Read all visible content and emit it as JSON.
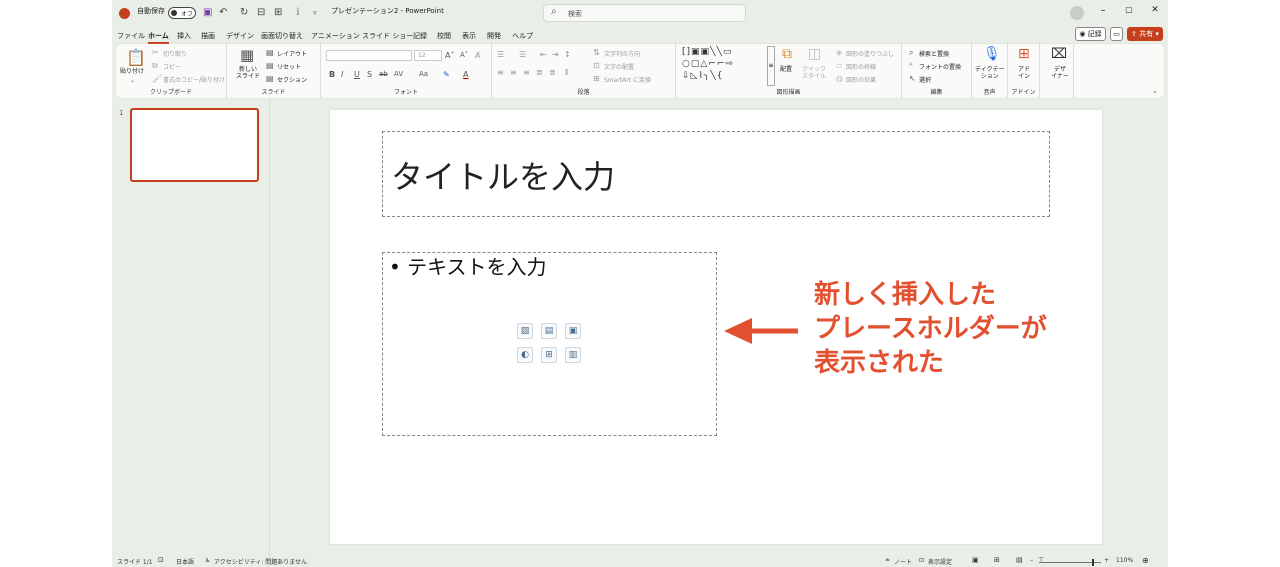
{
  "titlebar": {
    "autosave_label": "自動保存",
    "autosave_state": "オフ",
    "doc_title": "プレゼンテーション2 - PowerPoint",
    "search_placeholder": "検索",
    "win_min": "–",
    "win_max": "▢",
    "win_close": "✕"
  },
  "tabs": [
    "ファイル",
    "ホーム",
    "挿入",
    "描画",
    "デザイン",
    "画面切り替え",
    "アニメーション",
    "スライド ショー",
    "記録",
    "校閲",
    "表示",
    "開発",
    "ヘルプ"
  ],
  "active_tab": "ホーム",
  "top_right": {
    "record": "記録",
    "share": "共有"
  },
  "ribbon": {
    "clipboard": {
      "paste": "貼り付け",
      "cut": "切り取り",
      "copy": "コピー",
      "format_painter": "書式のコピー/貼り付け",
      "group": "クリップボード"
    },
    "slides": {
      "new_slide": "新しい\nスライド",
      "layout": "レイアウト",
      "reset": "リセット",
      "section": "セクション",
      "group": "スライド"
    },
    "font": {
      "size": "12",
      "group": "フォント",
      "styles": [
        "B",
        "I",
        "U",
        "S",
        "ab",
        "AV",
        "Aa",
        "A"
      ]
    },
    "paragraph": {
      "text_direction": "文字列の方向",
      "align_text": "文字の配置",
      "smartart": "SmartArt に変換",
      "group": "段落"
    },
    "drawing": {
      "arrange": "配置",
      "quick_styles": "クイック\nスタイル",
      "shape_fill": "図形の塗りつぶし",
      "shape_outline": "図形の枠線",
      "shape_effects": "図形の効果",
      "group": "図形描画"
    },
    "editing": {
      "find_replace": "検索と置換",
      "replace_font": "フォントの置換",
      "select": "選択",
      "group": "編集"
    },
    "voice": {
      "dictate": "ディクテー\nション",
      "group": "音声"
    },
    "addins": {
      "label": "アド\nイン",
      "group": "アドイン"
    },
    "designer": {
      "label": "デザ\nイナー"
    }
  },
  "thumbnail": {
    "number": "1"
  },
  "slide": {
    "title_placeholder": "タイトルを入力",
    "content_placeholder": "• テキストを入力"
  },
  "annotation": {
    "lines": [
      "新しく挿入した",
      "プレースホルダーが",
      "表示された"
    ],
    "color": "#e2502f"
  },
  "statusbar": {
    "slide_info": "スライド 1/1",
    "language": "日本語",
    "accessibility": "アクセシビリティ: 問題ありません",
    "notes": "ノート",
    "display_settings": "表示設定",
    "zoom": "110%"
  }
}
